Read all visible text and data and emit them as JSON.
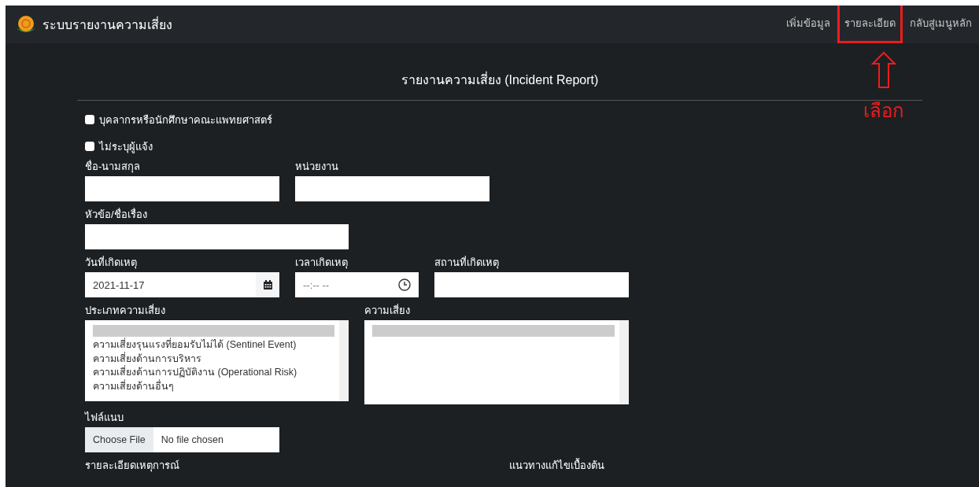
{
  "navbar": {
    "title": "ระบบรายงานความเสี่ยง",
    "links": [
      {
        "label": "เพิ่มข้อมูล",
        "highlighted": false
      },
      {
        "label": "รายละเอียด",
        "highlighted": true
      },
      {
        "label": "กลับสู่เมนูหลัก",
        "highlighted": false
      }
    ]
  },
  "annotation": {
    "label": "เลือก"
  },
  "form": {
    "title": "รายงานความเสี่ยง (Incident Report)",
    "checkboxes": [
      {
        "label": "บุคลากรหรือนักศึกษาคณะแพทยศาสตร์",
        "checked": false
      },
      {
        "label": "ไม่ระบุผู้แจ้ง",
        "checked": false
      }
    ],
    "name_label": "ชื่อ-นามสกุล",
    "unit_label": "หน่วยงาน",
    "subject_label": "หัวข้อ/ชื่อเรื่อง",
    "date": {
      "label": "วันที่เกิดเหตุ",
      "value": "2021-11-17"
    },
    "time": {
      "label": "เวลาเกิดเหตุ",
      "placeholder": "--:-- --"
    },
    "place_label": "สถานที่เกิดเหตุ",
    "risk_type": {
      "label": "ประเภทความเสี่ยง",
      "options": [
        {
          "selected": true
        },
        {
          "label": "ความเสี่ยงรุนแรงที่ยอมรับไม่ได้ (Sentinel Event)",
          "selected": false
        },
        {
          "label": "ความเสี่ยงด้านการบริหาร",
          "selected": false
        },
        {
          "label": "ความเสี่ยงด้านการปฏิบัติงาน (Operational Risk)",
          "selected": false
        },
        {
          "label": "ความเสี่ยงด้านอื่นๆ",
          "selected": false
        }
      ]
    },
    "risk": {
      "label": "ความเสี่ยง",
      "options": [
        {
          "selected": true
        }
      ]
    },
    "attachment": {
      "label": "ไฟล์แนบ",
      "button": "Choose File",
      "status": "No file chosen"
    },
    "details_label": "รายละเอียดเหตุการณ์",
    "solution_label": "แนวทางแก้ไขเบื้องต้น"
  }
}
